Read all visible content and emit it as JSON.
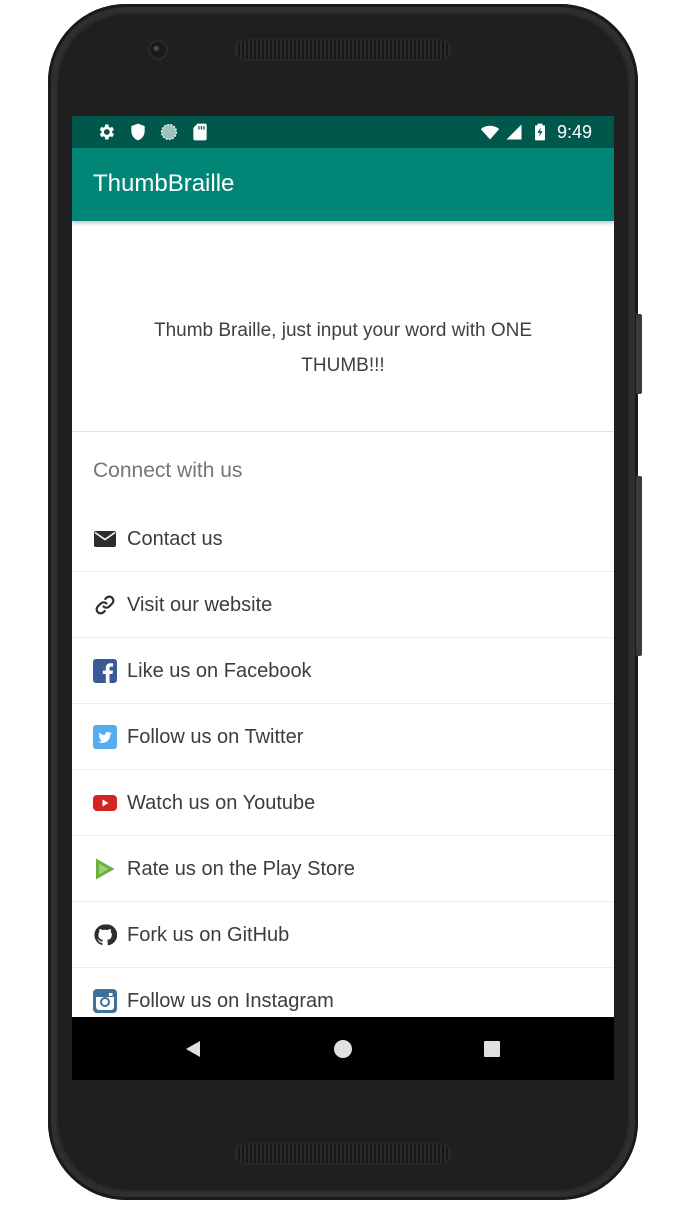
{
  "status_bar": {
    "time": "9:49",
    "left_icons": [
      "settings-icon",
      "shield-icon",
      "sync-circle-icon",
      "sd-card-icon"
    ],
    "right_icons": [
      "wifi-icon",
      "signal-icon",
      "battery-charging-icon"
    ]
  },
  "app_bar": {
    "title": "ThumbBraille"
  },
  "about": {
    "description": "Thumb Braille, just input your word with ONE THUMB!!!",
    "section_title": "Connect with us",
    "items": [
      {
        "label": "Contact us",
        "icon": "envelope-icon"
      },
      {
        "label": "Visit our website",
        "icon": "link-icon"
      },
      {
        "label": "Like us on Facebook",
        "icon": "facebook-icon"
      },
      {
        "label": "Follow us on Twitter",
        "icon": "twitter-icon"
      },
      {
        "label": "Watch us on Youtube",
        "icon": "youtube-icon"
      },
      {
        "label": "Rate us on the Play Store",
        "icon": "play-store-icon"
      },
      {
        "label": "Fork us on GitHub",
        "icon": "github-icon"
      },
      {
        "label": "Follow us on Instagram",
        "icon": "instagram-icon"
      }
    ]
  },
  "nav_bar": {
    "buttons": [
      "back-icon",
      "home-icon",
      "recents-icon"
    ]
  },
  "colors": {
    "status_bar": "#00574b",
    "app_bar": "#008577",
    "facebook": "#3b5998",
    "twitter": "#55acee",
    "youtube": "#d32323",
    "play_store": "#6ab23a"
  }
}
